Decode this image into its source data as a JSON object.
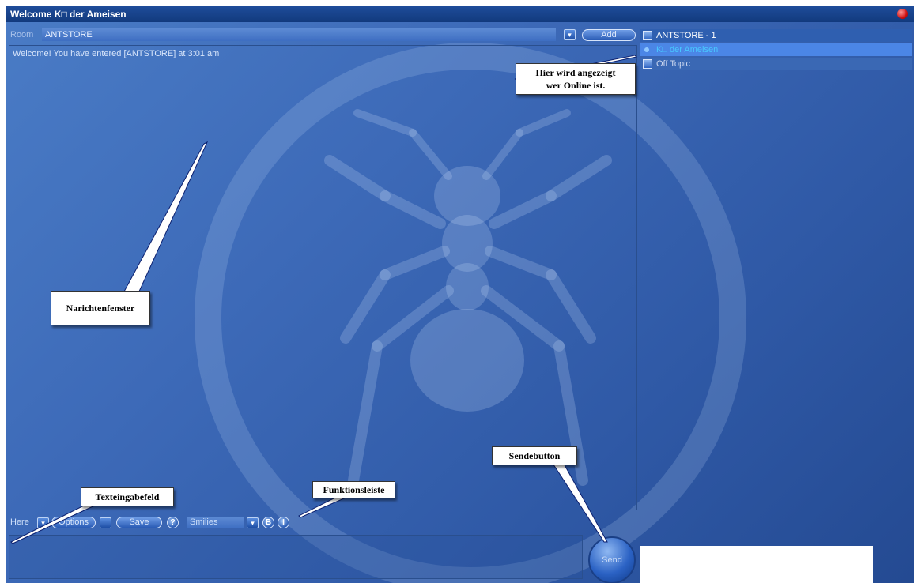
{
  "window": {
    "title": "Welcome K□ der Ameisen"
  },
  "roombar": {
    "label": "Room",
    "value": "ANTSTORE",
    "add_label": "Add"
  },
  "chat": {
    "welcome": "Welcome! You have entered [ANTSTORE] at 3:01 am"
  },
  "sidebar": {
    "room": "ANTSTORE - 1",
    "user": "K□ der Ameisen",
    "topic": "Off Topic"
  },
  "toolbar": {
    "here_label": "Here",
    "options_label": "Options",
    "save_label": "Save",
    "smilies_label": "Smilies"
  },
  "send": {
    "label": "Send"
  },
  "annotations": {
    "online_line1": "Hier wird angezeigt",
    "online_line2": "wer Online ist.",
    "messages": "Narichtenfenster",
    "send": "Sendebutton",
    "toolbar": "Funktionsleiste",
    "input": "Texteingabefeld"
  }
}
